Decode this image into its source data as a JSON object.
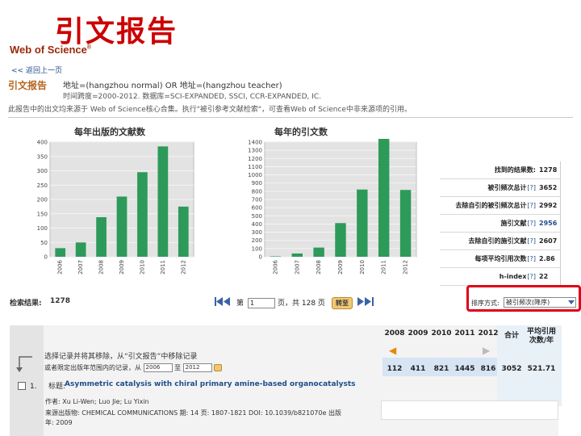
{
  "slide_title": "引文报告",
  "header": {
    "logo": "Web of Science",
    "logo_mark": "®",
    "back_link": "<< 返回上一页"
  },
  "report": {
    "title": "引文报告",
    "query": "地址=(hangzhou normal) OR 地址=(hangzhou teacher)",
    "timespan": "时间跨度=2000-2012. 数据库=SCI-EXPANDED, SSCI, CCR-EXPANDED, IC.",
    "note": "此报告中的出文均来源于 Web of Science核心合集。执行\"被引参考文献检索\"，可查看Web of Science中非来源项的引用。"
  },
  "chart_data": [
    {
      "type": "bar",
      "title": "每年出版的文献数",
      "categories": [
        "2006",
        "2007",
        "2008",
        "2009",
        "2010",
        "2011",
        "2012"
      ],
      "values": [
        30,
        50,
        138,
        210,
        295,
        385,
        175
      ],
      "ylim": [
        0,
        400
      ],
      "yticks": [
        0,
        50,
        100,
        150,
        200,
        250,
        300,
        350,
        400
      ],
      "color": "#2e9a5a",
      "grid": true
    },
    {
      "type": "bar",
      "title": "每年的引文数",
      "categories": [
        "2006",
        "2007",
        "2008",
        "2009",
        "2010",
        "2011",
        "2012"
      ],
      "values": [
        5,
        40,
        112,
        411,
        821,
        1445,
        816
      ],
      "ylim": [
        0,
        1400
      ],
      "yticks": [
        0,
        100,
        200,
        300,
        400,
        500,
        600,
        700,
        800,
        900,
        1000,
        1100,
        1200,
        1300,
        1400
      ],
      "color": "#2e9a5a",
      "grid": true
    }
  ],
  "stats": [
    {
      "label": "找到的结果数:",
      "help": "",
      "value": "1278",
      "link": false
    },
    {
      "label": "被引频次总计",
      "help": "[?]",
      "value": "3652",
      "link": false
    },
    {
      "label": "去除自引的被引频次总计",
      "help": "[?]",
      "value": "2992",
      "link": false
    },
    {
      "label": "施引文献",
      "help": "[?]",
      "value": "2956",
      "link": true
    },
    {
      "label": "去除自引的施引文献",
      "help": "[?]",
      "value": "2607",
      "link": false
    },
    {
      "label": "每项平均引用次数",
      "help": "[?]",
      "value": "2.86",
      "link": false
    },
    {
      "label": "h-index",
      "help": "[?]",
      "value": "22",
      "link": false
    }
  ],
  "pager": {
    "results_label": "检索结果:",
    "results_count": "1278",
    "page_prefix": "第",
    "page_value": "1",
    "page_suffix": "页，共 128 页",
    "go_label": "转至"
  },
  "sort": {
    "label": "排序方式:",
    "selected": "被引频次(降序)"
  },
  "year_table": {
    "headers": [
      "2008",
      "2009",
      "2010",
      "2011",
      "2012",
      "合计",
      "平均引用次数/年"
    ],
    "values": [
      "112",
      "411",
      "821",
      "1445",
      "816",
      "3052",
      "521.71"
    ]
  },
  "instructions": {
    "line1": "选择记录并将其移除，从“引文报告”中移除记录",
    "line2_prefix": "或者限定出版年范围内的记录，从",
    "from_year": "2006",
    "to_label": "至",
    "to_year": "2012"
  },
  "record": {
    "number": "1.",
    "title_label": "标题:",
    "title": "Asymmetric catalysis with chiral primary amine-based organocatalysts",
    "authors": "作者: Xu Li-Wen; Luo Jie; Lu Yixin",
    "source": "来源出版物: CHEMICAL COMMUNICATIONS 期: 14 页: 1807-1821 DOI: 10.1039/b821070e 出版",
    "year": "年: 2009"
  }
}
